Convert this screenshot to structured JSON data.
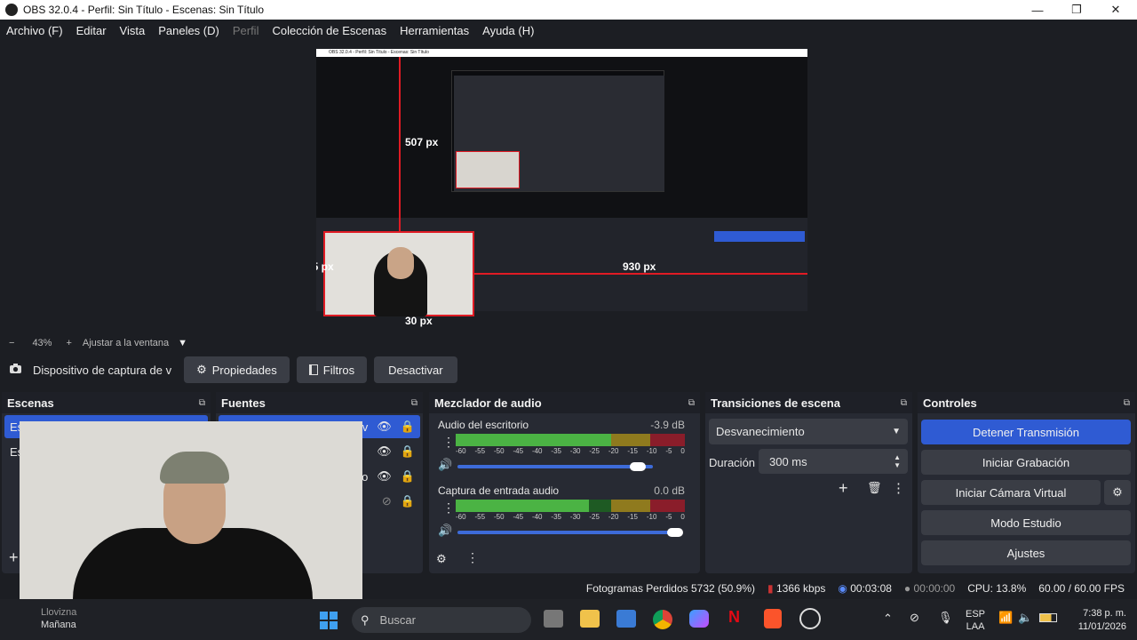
{
  "window": {
    "title": "OBS 32.0.4 - Perfil: Sin Título - Escenas: Sin Título",
    "minimize": "—",
    "maximize": "❐",
    "close": "✕"
  },
  "menu": [
    {
      "label": "Archivo (F)"
    },
    {
      "label": "Editar"
    },
    {
      "label": "Vista"
    },
    {
      "label": "Paneles (D)"
    },
    {
      "label": "Perfil"
    },
    {
      "label": "Colección de Escenas"
    },
    {
      "label": "Herramientas"
    },
    {
      "label": "Ayuda (H)"
    }
  ],
  "preview": {
    "measure_top": "507 px",
    "measure_left": "25 px",
    "measure_right": "930 px",
    "measure_bottom": "30 px",
    "inner_title": "OBS 32.0.4 - Perfil: Sin Título - Escenas: Sin Título"
  },
  "zoom": {
    "minus": "−",
    "value": "43%",
    "plus": "+",
    "fit": "Ajustar a la ventana",
    "dropdown": "▼"
  },
  "source_toolbar": {
    "source_name": "Dispositivo de captura de v",
    "properties": "Propiedades",
    "filters": "Filtros",
    "deactivate": "Desactivar"
  },
  "docks": {
    "scenes": {
      "title": "Escenas",
      "items": [
        "Es",
        "Es"
      ],
      "add": "+"
    },
    "sources": {
      "title": "Fuentes",
      "items": [
        "e v",
        "",
        "o",
        ""
      ]
    },
    "mixer": {
      "title": "Mezclador de audio",
      "channels": [
        {
          "name": "Audio del escritorio",
          "db": "-3.9 dB",
          "level": 0.9,
          "volume": 0.83
        },
        {
          "name": "Captura de entrada audio",
          "db": "0.0 dB",
          "level": 0.7,
          "volume": 1.0
        }
      ],
      "ticks": [
        "-60",
        "-55",
        "-50",
        "-45",
        "-40",
        "-35",
        "-30",
        "-25",
        "-20",
        "-15",
        "-10",
        "-5",
        "0"
      ]
    },
    "transitions": {
      "title": "Transiciones de escena",
      "selected": "Desvanecimiento",
      "duration_label": "Duración",
      "duration": "300 ms"
    },
    "controls": {
      "title": "Controles",
      "buttons": [
        "Detener Transmisión",
        "Iniciar Grabación",
        "Iniciar Cámara Virtual",
        "Modo Estudio",
        "Ajustes"
      ]
    }
  },
  "status": {
    "dropped": "Fotogramas Perdidos 5732 (50.9%)",
    "bitrate": "1366 kbps",
    "stream_time": "00:03:08",
    "rec_time": "00:00:00",
    "cpu": "CPU: 13.8%",
    "fps": "60.00 / 60.00 FPS"
  },
  "taskbar": {
    "weather_line1": "Llovizna",
    "weather_line2": "Mañana",
    "search": "Buscar",
    "lang1": "ESP",
    "lang2": "LAA",
    "time": "7:38 p. m.",
    "date": "11/01/2026"
  },
  "colors": {
    "accent": "#2f5bd3",
    "dock_bg": "#272a33",
    "window_bg": "#1c1e23",
    "measure": "#e01b24"
  }
}
